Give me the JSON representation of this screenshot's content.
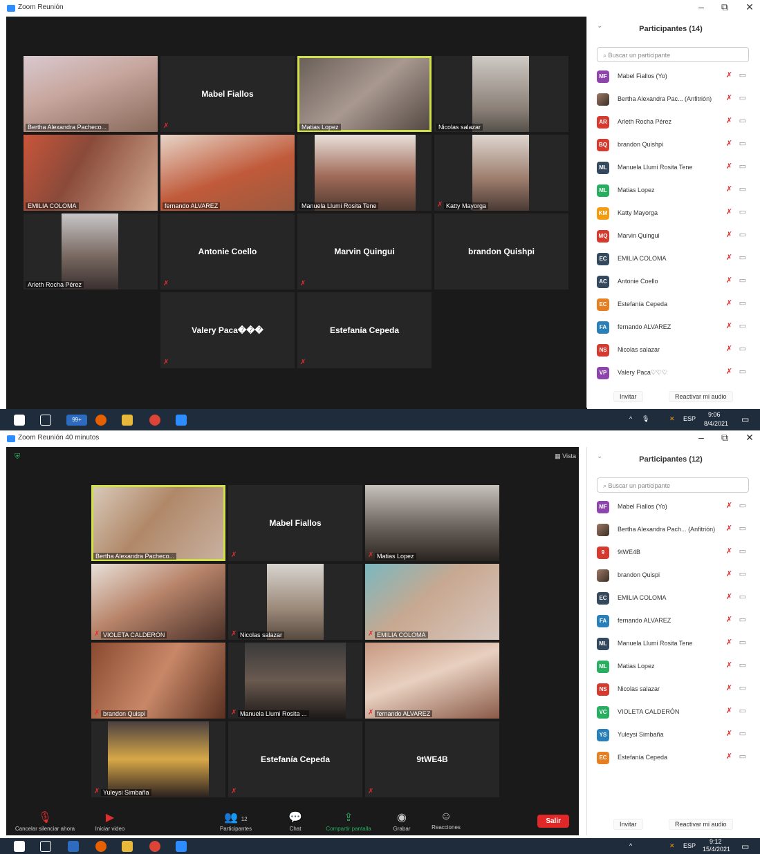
{
  "top": {
    "window_title": "Zoom Reunión",
    "minimize": "–",
    "restore": "⧉",
    "close": "✕",
    "tiles": [
      {
        "label": "Bertha Alexandra Pacheco..."
      },
      {
        "label": "Mabel Fiallos"
      },
      {
        "label": "Matias Lopez"
      },
      {
        "label": "Nicolas salazar"
      },
      {
        "label": "EMILIA COLOMA"
      },
      {
        "label": "fernando ALVAREZ"
      },
      {
        "label": "Manuela Llumi Rosita Tene"
      },
      {
        "label": "Katty Mayorga"
      },
      {
        "label": "Arleth Rocha Pérez"
      },
      {
        "label": "Antonie Coello"
      },
      {
        "label": "Marvin Quingui"
      },
      {
        "label": "brandon Quishpi"
      },
      {
        "label": "Valery Paca���"
      },
      {
        "label": "Estefanía Cepeda"
      }
    ],
    "panel": {
      "title": "Participantes (14)",
      "search_placeholder": "Buscar un participante",
      "participants": [
        {
          "initials": "MF",
          "name": "Mabel Fiallos (Yo)",
          "color": "#8e44ad"
        },
        {
          "initials": "",
          "name": "Bertha Alexandra Pac... (Anfitrión)",
          "color": "#6b4f40"
        },
        {
          "initials": "AR",
          "name": "Arleth Rocha Pérez",
          "color": "#d63a2f"
        },
        {
          "initials": "BQ",
          "name": "brandon Quishpi",
          "color": "#d63a2f"
        },
        {
          "initials": "ML",
          "name": "Manuela Llumi Rosita Tene",
          "color": "#34495e"
        },
        {
          "initials": "ML",
          "name": "Matias Lopez",
          "color": "#27ae60"
        },
        {
          "initials": "KM",
          "name": "Katty Mayorga",
          "color": "#f39c12"
        },
        {
          "initials": "MQ",
          "name": "Marvin Quingui",
          "color": "#d63a2f"
        },
        {
          "initials": "EC",
          "name": "EMILIA COLOMA",
          "color": "#34495e"
        },
        {
          "initials": "AC",
          "name": "Antonie Coello",
          "color": "#34495e"
        },
        {
          "initials": "EC",
          "name": "Estefanía Cepeda",
          "color": "#e67e22"
        },
        {
          "initials": "FA",
          "name": "fernando ALVAREZ",
          "color": "#2980b9"
        },
        {
          "initials": "NS",
          "name": "Nicolas salazar",
          "color": "#d63a2f"
        },
        {
          "initials": "VP",
          "name": "Valery Paca♡♡♡",
          "color": "#8e44ad"
        }
      ],
      "invite": "Invitar",
      "unmute_me": "Reactivar mi audio"
    },
    "taskbar": {
      "badge": "99+",
      "lang": "ESP",
      "time": "9:06",
      "date": "8/4/2021"
    }
  },
  "bottom": {
    "window_title": "Zoom Reunión 40 minutos",
    "minimize": "–",
    "restore": "⧉",
    "close": "✕",
    "view_label": "Vista",
    "tiles": [
      {
        "label": "Bertha Alexandra Pacheco..."
      },
      {
        "label": "Mabel Fiallos"
      },
      {
        "label": "Matias Lopez"
      },
      {
        "label": "VIOLETA CALDERÓN"
      },
      {
        "label": "Nicolas salazar"
      },
      {
        "label": "EMILIA COLOMA"
      },
      {
        "label": "brandon Quispi"
      },
      {
        "label": "Manuela Llumi Rosita ..."
      },
      {
        "label": "fernando ALVAREZ"
      },
      {
        "label": "Yuleysi Simbaña"
      },
      {
        "label": "Estefanía Cepeda"
      },
      {
        "label": "9tWE4B"
      }
    ],
    "panel": {
      "title": "Participantes (12)",
      "search_placeholder": "Buscar un participante",
      "participants": [
        {
          "initials": "MF",
          "name": "Mabel Fiallos (Yo)",
          "color": "#8e44ad"
        },
        {
          "initials": "",
          "name": "Bertha Alexandra Pach... (Anfitrión)",
          "color": "#6b4f40"
        },
        {
          "initials": "9",
          "name": "9tWE4B",
          "color": "#d63a2f"
        },
        {
          "initials": "",
          "name": "brandon Quispi",
          "color": "#7a8a6a"
        },
        {
          "initials": "EC",
          "name": "EMILIA COLOMA",
          "color": "#34495e"
        },
        {
          "initials": "FA",
          "name": "fernando ALVAREZ",
          "color": "#2980b9"
        },
        {
          "initials": "ML",
          "name": "Manuela Llumi Rosita Tene",
          "color": "#34495e"
        },
        {
          "initials": "ML",
          "name": "Matias Lopez",
          "color": "#27ae60"
        },
        {
          "initials": "NS",
          "name": "Nicolas salazar",
          "color": "#d63a2f"
        },
        {
          "initials": "VC",
          "name": "VIOLETA CALDERÓN",
          "color": "#27ae60"
        },
        {
          "initials": "YS",
          "name": "Yuleysi Simbaña",
          "color": "#2980b9"
        },
        {
          "initials": "EC",
          "name": "Estefanía Cepeda",
          "color": "#e67e22"
        }
      ],
      "invite": "Invitar",
      "unmute_me": "Reactivar mi audio"
    },
    "toolbar": {
      "unmute": "Cancelar silenciar ahora",
      "video": "Iniciar video",
      "participants": "Participantes",
      "participants_count": "12",
      "chat": "Chat",
      "share": "Compartir pantalla",
      "record": "Grabar",
      "reactions": "Reacciones",
      "leave": "Salir"
    },
    "taskbar": {
      "lang": "ESP",
      "time": "9:12",
      "date": "15/4/2021"
    }
  }
}
